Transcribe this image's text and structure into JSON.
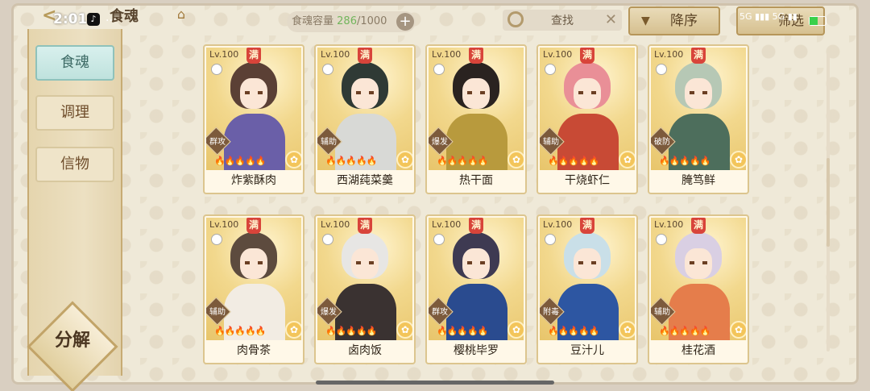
{
  "status_bar": {
    "time": "2:01",
    "dots": "..",
    "battery": "25"
  },
  "header": {
    "title": "食魂",
    "capacity_label": "食魂容量",
    "capacity_current": "286",
    "capacity_max": "/1000",
    "capacity_plus": "+",
    "search_placeholder": "查找",
    "search_clear": "✕",
    "sort_label": "降序",
    "filter_label": "筛选"
  },
  "sidebar": {
    "items": [
      {
        "label": "食魂",
        "active": true
      },
      {
        "label": "调理",
        "active": false
      },
      {
        "label": "信物",
        "active": false
      }
    ],
    "decompose_label": "分解"
  },
  "cards": [
    {
      "level": "Lv.100",
      "badge": "满",
      "role": "群攻",
      "name": "炸紫酥肉",
      "hair": "#5b4035",
      "outfit": "#6a5fa8"
    },
    {
      "level": "Lv.100",
      "badge": "满",
      "role": "辅助",
      "name": "西湖莼菜羹",
      "hair": "#2f3a35",
      "outfit": "#d8d9d6"
    },
    {
      "level": "Lv.100",
      "badge": "满",
      "role": "爆发",
      "name": "热干面",
      "hair": "#2a2320",
      "outfit": "#b89a3d"
    },
    {
      "level": "Lv.100",
      "badge": "满",
      "role": "辅助",
      "name": "干烧虾仁",
      "hair": "#e98f97",
      "outfit": "#c84a35"
    },
    {
      "level": "Lv.100",
      "badge": "满",
      "role": "破防",
      "name": "腌笃鲜",
      "hair": "#b6c8b5",
      "outfit": "#4d6e5c"
    },
    {
      "level": "Lv.100",
      "badge": "满",
      "role": "辅助",
      "name": "肉骨茶",
      "hair": "#5d4b3e",
      "outfit": "#f2ece3"
    },
    {
      "level": "Lv.100",
      "badge": "满",
      "role": "爆发",
      "name": "卤肉饭",
      "hair": "#e7e6e4",
      "outfit": "#3a3231"
    },
    {
      "level": "Lv.100",
      "badge": "满",
      "role": "群攻",
      "name": "樱桃毕罗",
      "hair": "#3e3a52",
      "outfit": "#2a4b8f"
    },
    {
      "level": "Lv.100",
      "badge": "满",
      "role": "附毒",
      "name": "豆汁儿",
      "hair": "#c9dfe8",
      "outfit": "#2d56a2"
    },
    {
      "level": "Lv.100",
      "badge": "满",
      "role": "辅助",
      "name": "桂花酒",
      "hair": "#d9cfe3",
      "outfit": "#e57d4b"
    }
  ]
}
